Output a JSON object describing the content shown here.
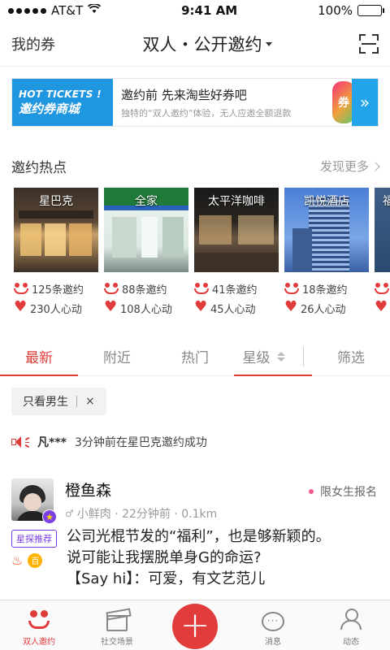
{
  "status": {
    "carrier": "AT&T",
    "time": "9:41 AM",
    "battery": "100%"
  },
  "nav": {
    "left": "我的券",
    "title": "双人・公开邀约"
  },
  "banner": {
    "badge_line1": "HOT TICKETS !",
    "badge_line2": "邀约券商城",
    "title": "邀约前 先来淘些好券吧",
    "subtitle": "独特的“双人邀约”体验，无人应邀全额退款",
    "mascot_text": "券"
  },
  "hot": {
    "title": "邀约热点",
    "more": "发现更多",
    "items": [
      {
        "name": "星巴克",
        "invites": "125条邀约",
        "likes": "230人心动"
      },
      {
        "name": "全家",
        "invites": "88条邀约",
        "likes": "108人心动"
      },
      {
        "name": "太平洋咖啡",
        "invites": "41条邀约",
        "likes": "45人心动"
      },
      {
        "name": "凯悦酒店",
        "invites": "18条邀约",
        "likes": "26人心动"
      },
      {
        "name": "福",
        "invites": "",
        "likes": ""
      }
    ]
  },
  "tabs": {
    "newest": "最新",
    "nearby": "附近",
    "hot": "热门",
    "star": "星级",
    "filter": "筛选"
  },
  "filter_chip": {
    "label": "只看男生",
    "close": "×"
  },
  "notice": {
    "who": "凡***",
    "text": "3分钟前在星巴克邀约成功"
  },
  "post": {
    "name": "橙鱼森",
    "meta": "小鲜肉 · 22分钟前 · 0.1km",
    "tag": "限女生报名",
    "rec": "星探推荐",
    "medal": "百",
    "lines": [
      "公司光棍节发的“福利”，也是够新颖的。",
      "说可能让我摆脱单身G的命运?",
      "【Say hi】：可爱，有文艺范儿"
    ]
  },
  "tabbar": {
    "invite": "双人邀约",
    "scene": "社交场景",
    "plus": "+",
    "news": "消息",
    "feed": "动态"
  },
  "colors": {
    "accent": "#e23b3b",
    "banner_blue": "#1f96e0",
    "purple": "#7b3fe4"
  }
}
